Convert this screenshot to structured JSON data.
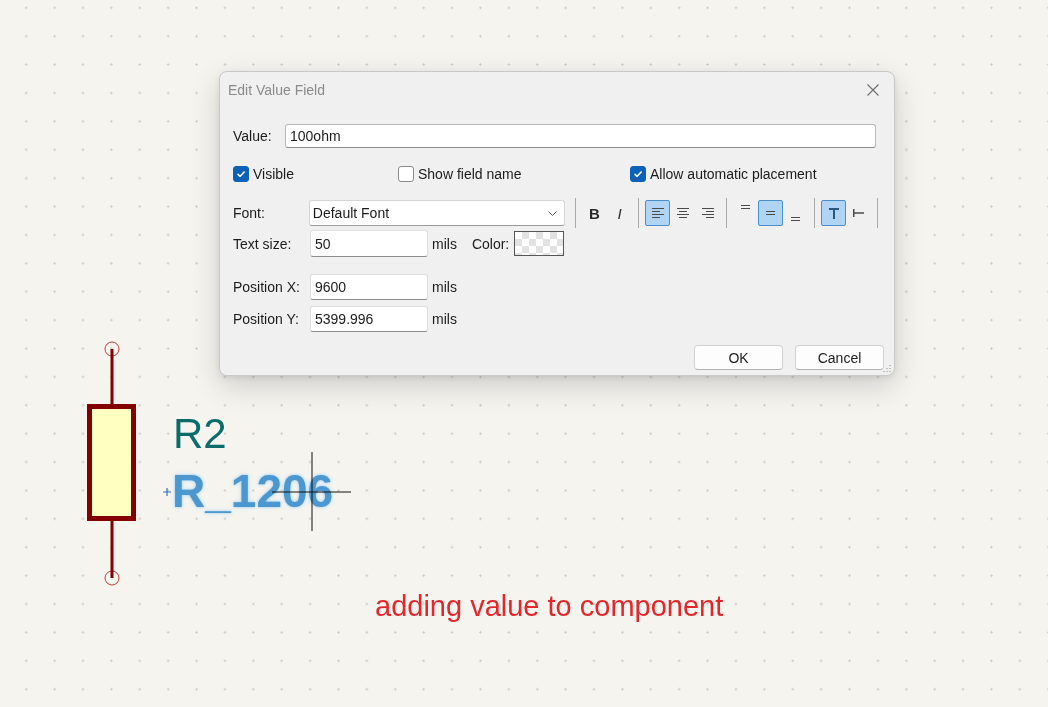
{
  "dialog": {
    "title": "Edit Value Field",
    "value_field": {
      "label": "Value:",
      "value": "100ohm"
    },
    "checkboxes": [
      {
        "label": "Visible",
        "checked": true
      },
      {
        "label": "Show field name",
        "checked": false
      },
      {
        "label": "Allow automatic placement",
        "checked": true
      }
    ],
    "font": {
      "label": "Font:",
      "value": "Default Font"
    },
    "toolbar": [
      {
        "buttons": [
          {
            "kind": "bold",
            "label": "B",
            "selected": false
          },
          {
            "kind": "italic",
            "label": "I",
            "selected": false
          }
        ]
      },
      {
        "buttons": [
          {
            "kind": "left",
            "selected": true
          },
          {
            "kind": "center",
            "selected": false
          },
          {
            "kind": "right",
            "selected": false
          }
        ]
      },
      {
        "buttons": [
          {
            "kind": "top",
            "selected": false
          },
          {
            "kind": "middle",
            "selected": true
          },
          {
            "kind": "bottom",
            "selected": false
          }
        ]
      },
      {
        "buttons": [
          {
            "kind": "horizontal",
            "selected": true
          },
          {
            "kind": "vertical",
            "selected": false
          }
        ]
      }
    ],
    "text_size": {
      "label": "Text size:",
      "value": "50",
      "unit": "mils"
    },
    "color": {
      "label": "Color:"
    },
    "position_fields": [
      {
        "label": "Position X:",
        "value": "9600",
        "unit": "mils"
      },
      {
        "label": "Position Y:",
        "value": "5399.996",
        "unit": "mils"
      }
    ],
    "buttons": [
      {
        "label": "OK"
      },
      {
        "label": "Cancel"
      }
    ]
  },
  "schematic": {
    "reference": "R2",
    "value": {
      "text": "R_1206",
      "selected": true
    }
  },
  "caption": "adding value to component"
}
